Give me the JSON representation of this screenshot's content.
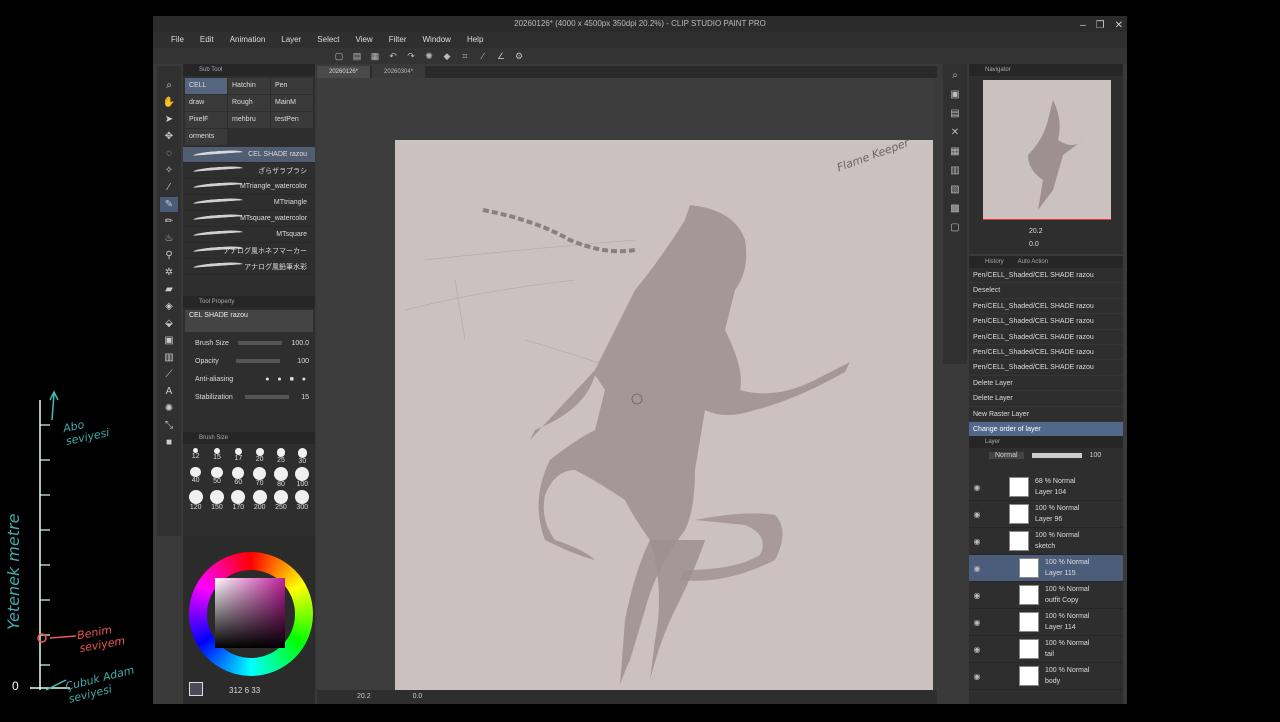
{
  "app": {
    "title": "20260126* (4000 x 4500px 350dpi 20.2%) - CLIP STUDIO PAINT PRO",
    "window_controls": [
      "–",
      "❐",
      "✕"
    ]
  },
  "menu": [
    "File",
    "Edit",
    "Animation",
    "Layer",
    "Select",
    "View",
    "Filter",
    "Window",
    "Help"
  ],
  "doc_tabs": [
    "20260126*",
    "20260304*"
  ],
  "subtool": {
    "panel_title": "Sub Tool",
    "groups": [
      "CELL",
      "Hatchin",
      "Pen",
      "draw",
      "Rough",
      "MainM",
      "PixelF",
      "mehbru",
      "testPen",
      "orments"
    ],
    "brushes": [
      "CEL SHADE razou",
      "ざらザラブラシ",
      "MTriangle_watercolor",
      "MTtriangle",
      "MTsquare_watercolor",
      "MTsquare",
      "アナログ風ホネフマーカー",
      "アナログ風鉛筆水彩"
    ]
  },
  "tool_property": {
    "panel_title": "Tool Property",
    "preset": "CEL SHADE razou",
    "rows": [
      {
        "label": "Brush Size",
        "value": "100.0"
      },
      {
        "label": "Opacity",
        "value": "100"
      },
      {
        "label": "Anti-aliasing",
        "value": ""
      },
      {
        "label": "Stabilization",
        "value": "15"
      }
    ]
  },
  "brush_size": {
    "panel_title": "Brush Size",
    "sizes": [
      "12",
      "15",
      "17",
      "20",
      "25",
      "30",
      "40",
      "50",
      "60",
      "70",
      "80",
      "100",
      "120",
      "150",
      "170",
      "200",
      "250",
      "300"
    ]
  },
  "color": {
    "values": "312  6  33",
    "current": "#4a4a5a"
  },
  "canvas": {
    "signature": "Flame Keeper",
    "status_zoom": "20.2",
    "status_angle": "0.0"
  },
  "navigator": {
    "panel_title": "Navigator",
    "zoom": "20.2",
    "angle": "0.0"
  },
  "history": {
    "panel_title": "History",
    "tab2": "Auto Action",
    "items": [
      "Pen/CELL_Shaded/CEL SHADE razou",
      "Deselect",
      "Pen/CELL_Shaded/CEL SHADE razou",
      "Pen/CELL_Shaded/CEL SHADE razou",
      "Pen/CELL_Shaded/CEL SHADE razou",
      "Pen/CELL_Shaded/CEL SHADE razou",
      "Pen/CELL_Shaded/CEL SHADE razou",
      "Delete Layer",
      "Delete Layer",
      "New Raster Layer",
      "Change order of layer"
    ]
  },
  "layers": {
    "panel_title": "Layer",
    "blend_mode": "Normal",
    "opacity": "100",
    "items": [
      {
        "mode": "68 % Normal",
        "name": "Layer 104"
      },
      {
        "mode": "100 % Normal",
        "name": "Layer 96"
      },
      {
        "mode": "100 % Normal",
        "name": "sketch"
      },
      {
        "mode": "100 % Normal",
        "name": "Layer 115"
      },
      {
        "mode": "100 % Normal",
        "name": "outfit Copy"
      },
      {
        "mode": "100 % Normal",
        "name": "Layer 114"
      },
      {
        "mode": "100 % Normal",
        "name": "tail"
      },
      {
        "mode": "100 % Normal",
        "name": "body"
      }
    ]
  },
  "overlay": {
    "vertical_label": "Yetenek metre",
    "top_label": "Abo seviyesi",
    "mid_label": "Benim seviyem",
    "bottom_label": "Çubuk Adam seviyesi",
    "zero": "0"
  },
  "theme": {
    "accent": "#52678c",
    "canvas_bg": "#cbc1c0",
    "figure": "#9e8f92"
  }
}
